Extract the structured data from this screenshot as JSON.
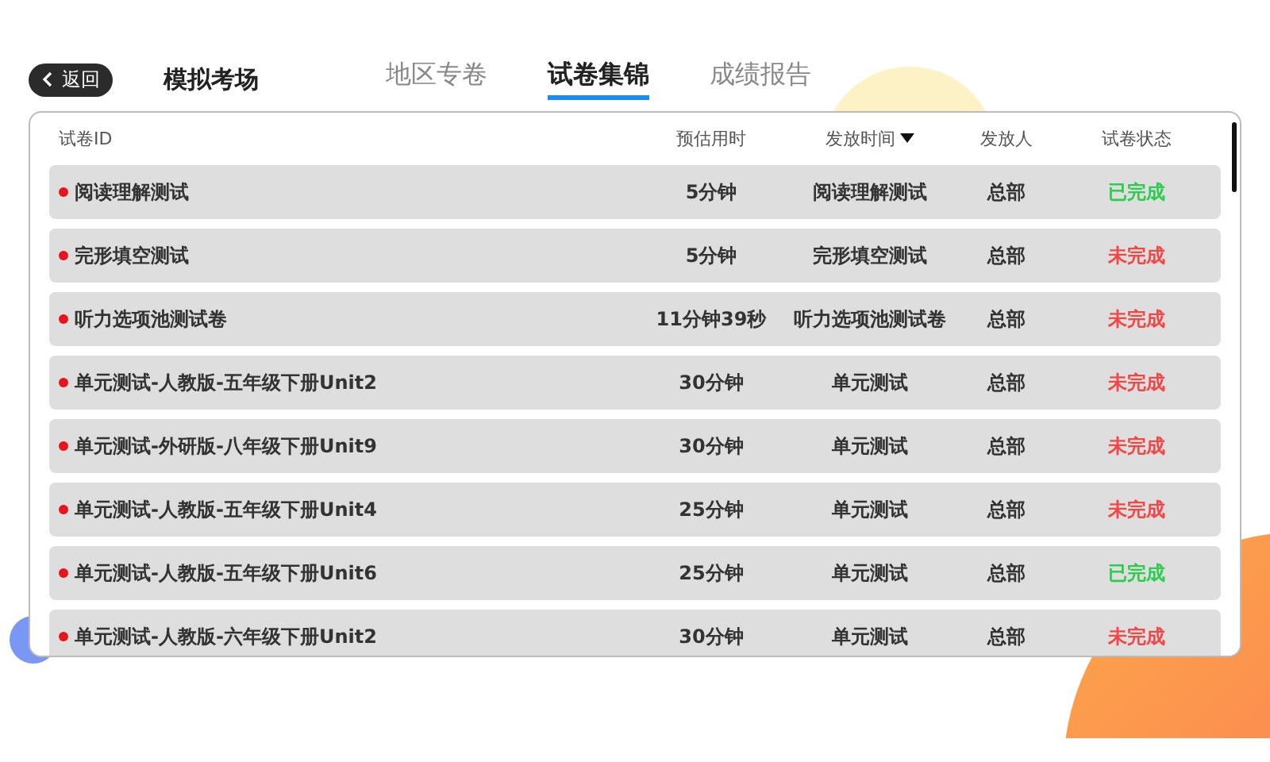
{
  "header": {
    "back_button": "返回",
    "title": "模拟考场"
  },
  "tabs": [
    {
      "label": "地区专卷",
      "selected": false
    },
    {
      "label": "试卷集锦",
      "selected": true
    },
    {
      "label": "成绩报告",
      "selected": false
    }
  ],
  "table": {
    "columns": [
      {
        "label": "试卷ID",
        "sorted": false
      },
      {
        "label": "预估用时",
        "sorted": false
      },
      {
        "label": "发放时间",
        "sorted": true
      },
      {
        "label": "发放人",
        "sorted": false
      },
      {
        "label": "试卷状态",
        "sorted": false
      }
    ],
    "rows": [
      {
        "name": "阅读理解测试",
        "duration": "5分钟",
        "release": "阅读理解测试",
        "publisher": "总部",
        "status": "已完成",
        "completed": true
      },
      {
        "name": "完形填空测试",
        "duration": "5分钟",
        "release": "完形填空测试",
        "publisher": "总部",
        "status": "未完成",
        "completed": false
      },
      {
        "name": "听力选项池测试卷",
        "duration": "11分钟39秒",
        "release": "听力选项池测试卷",
        "publisher": "总部",
        "status": "未完成",
        "completed": false
      },
      {
        "name": "单元测试-人教版-五年级下册Unit2",
        "duration": "30分钟",
        "release": "单元测试",
        "publisher": "总部",
        "status": "未完成",
        "completed": false
      },
      {
        "name": "单元测试-外研版-八年级下册Unit9",
        "duration": "30分钟",
        "release": "单元测试",
        "publisher": "总部",
        "status": "未完成",
        "completed": false
      },
      {
        "name": "单元测试-人教版-五年级下册Unit4",
        "duration": "25分钟",
        "release": "单元测试",
        "publisher": "总部",
        "status": "未完成",
        "completed": false
      },
      {
        "name": "单元测试-人教版-五年级下册Unit6",
        "duration": "25分钟",
        "release": "单元测试",
        "publisher": "总部",
        "status": "已完成",
        "completed": true
      },
      {
        "name": "单元测试-人教版-六年级下册Unit2",
        "duration": "30分钟",
        "release": "单元测试",
        "publisher": "总部",
        "status": "未完成",
        "completed": false
      }
    ]
  }
}
